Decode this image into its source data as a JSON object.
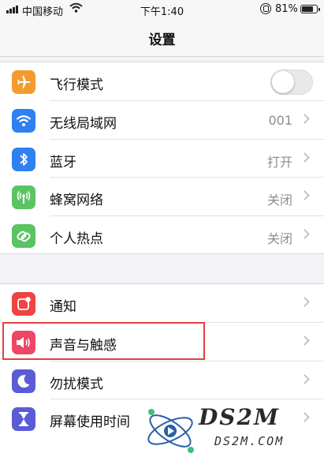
{
  "status_bar": {
    "carrier": "中国移动",
    "time": "下午1:40",
    "battery_percent": "81%",
    "battery_level": 0.81
  },
  "header": {
    "title": "设置"
  },
  "group1": [
    {
      "label": "飞行模式",
      "icon": "airplane-icon",
      "color": "#f39c2d",
      "toggle_on": false
    },
    {
      "label": "无线局域网",
      "icon": "wifi-icon",
      "color": "#2f80f0",
      "value": "001"
    },
    {
      "label": "蓝牙",
      "icon": "bluetooth-icon",
      "color": "#2f80f0",
      "value": "打开"
    },
    {
      "label": "蜂窝网络",
      "icon": "antenna-icon",
      "color": "#5ac463",
      "value": "关闭"
    },
    {
      "label": "个人热点",
      "icon": "hotspot-icon",
      "color": "#5ac463",
      "value": "关闭"
    }
  ],
  "group2": [
    {
      "label": "通知",
      "icon": "notification-icon",
      "color": "#ee4444"
    },
    {
      "label": "声音与触感",
      "icon": "speaker-icon",
      "color": "#ef4666"
    },
    {
      "label": "勿扰模式",
      "icon": "moon-icon",
      "color": "#5b5bd6"
    },
    {
      "label": "屏幕使用时间",
      "icon": "hourglass-icon",
      "color": "#5b5bd6"
    }
  ],
  "highlight_color": "#e2403c",
  "watermark": {
    "main": "DS2M",
    "sub": "DS2M.COM"
  }
}
